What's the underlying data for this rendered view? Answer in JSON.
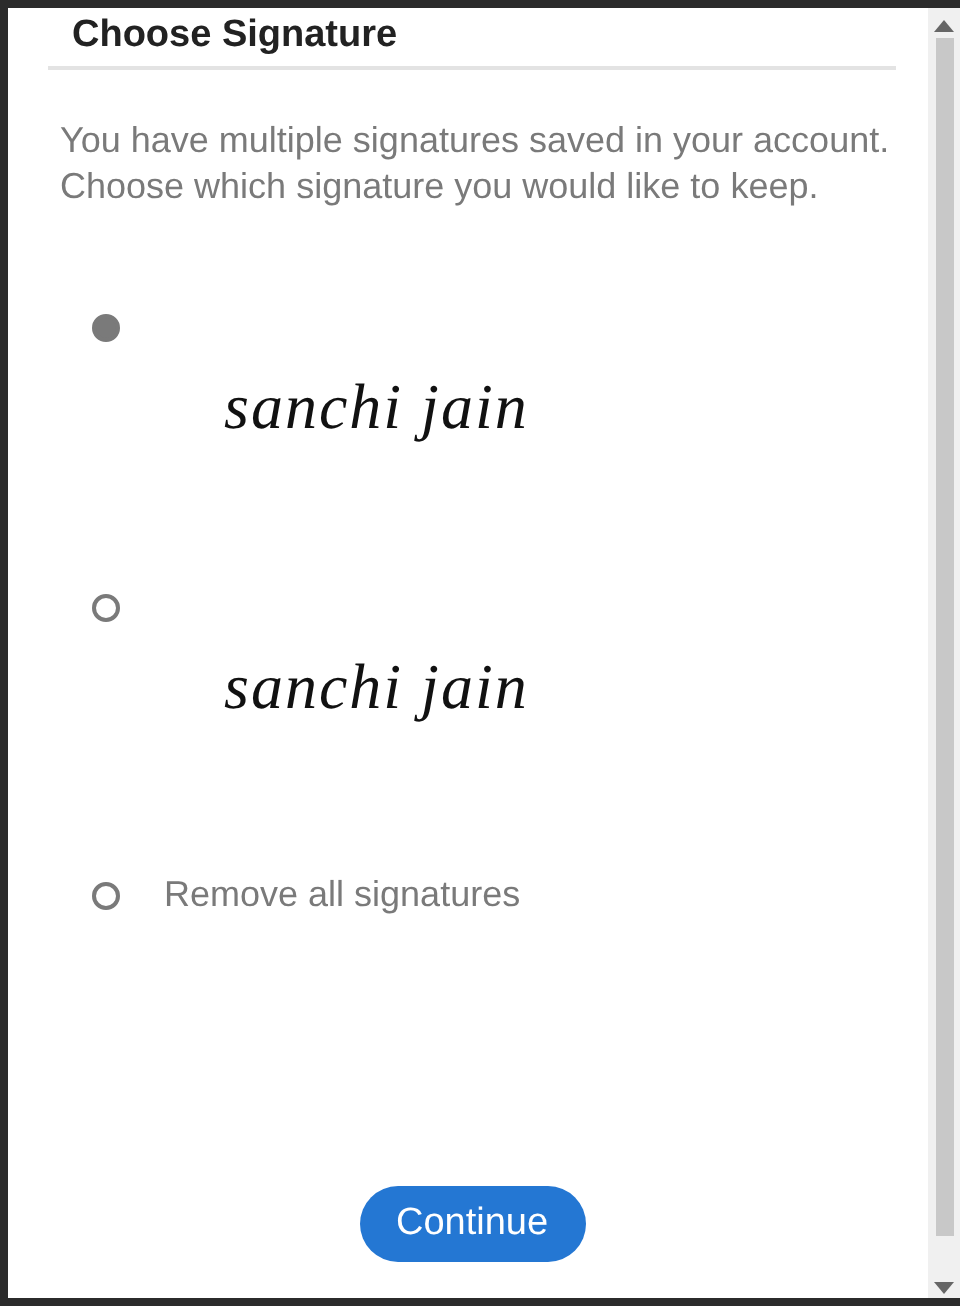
{
  "dialog": {
    "title": "Choose Signature",
    "message": "You have multiple signatures saved in your account. Choose which signature you would like to keep."
  },
  "options": [
    {
      "kind": "signature",
      "signature": "sanchi jain",
      "selected": true
    },
    {
      "kind": "signature",
      "signature": "sanchi jain",
      "selected": false
    },
    {
      "kind": "text",
      "label": "Remove all signatures",
      "selected": false
    }
  ],
  "buttons": [
    {
      "label": "Continue"
    }
  ]
}
